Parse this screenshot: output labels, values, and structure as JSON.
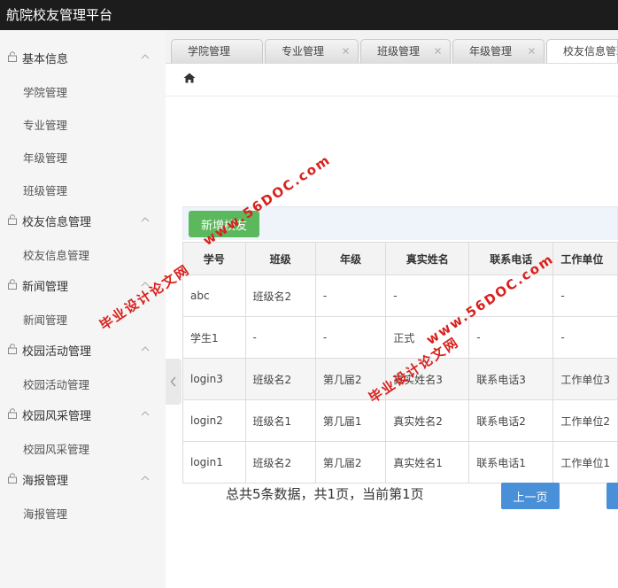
{
  "app": {
    "title": "航院校友管理平台"
  },
  "sidebar": {
    "groups": [
      {
        "title": "基本信息",
        "items": [
          "学院管理",
          "专业管理",
          "年级管理",
          "班级管理"
        ]
      },
      {
        "title": "校友信息管理",
        "items": [
          "校友信息管理"
        ]
      },
      {
        "title": "新闻管理",
        "items": [
          "新闻管理"
        ]
      },
      {
        "title": "校园活动管理",
        "items": [
          "校园活动管理"
        ]
      },
      {
        "title": "校园风采管理",
        "items": [
          "校园风采管理"
        ]
      },
      {
        "title": "海报管理",
        "items": [
          "海报管理"
        ]
      }
    ]
  },
  "tabs": [
    {
      "label": "学院管理",
      "active": false
    },
    {
      "label": "专业管理",
      "active": false
    },
    {
      "label": "班级管理",
      "active": false
    },
    {
      "label": "年级管理",
      "active": false
    },
    {
      "label": "校友信息管理",
      "active": true
    }
  ],
  "toolbar": {
    "add_label": "新增校友"
  },
  "table": {
    "headers": [
      "学号",
      "班级",
      "年级",
      "真实姓名",
      "联系电话",
      "工作单位"
    ],
    "rows": [
      [
        "abc",
        "班级名2",
        "-",
        "-",
        "",
        "-"
      ],
      [
        "学生1",
        "-",
        "-",
        "正式",
        "-",
        "-"
      ],
      [
        "login3",
        "班级名2",
        "第几届2",
        "真实姓名3",
        "联系电话3",
        "工作单位3"
      ],
      [
        "login2",
        "班级名1",
        "第几届1",
        "真实姓名2",
        "联系电话2",
        "工作单位2"
      ],
      [
        "login1",
        "班级名2",
        "第几届2",
        "真实姓名1",
        "联系电话1",
        "工作单位1"
      ]
    ]
  },
  "pager": {
    "summary": "总共5条数据，共1页，当前第1页",
    "prev_label": "上一页"
  },
  "watermarks": [
    {
      "site": "www.56DOC.com",
      "cn": "毕业设计论文网"
    },
    {
      "site": "www.56DOC.com",
      "cn": "毕业设计论文网"
    }
  ],
  "colors": {
    "topbar": "#1c1c1c",
    "add_button": "#5cb85c",
    "pager_button": "#4a90d9",
    "watermark": "#d9211c"
  }
}
